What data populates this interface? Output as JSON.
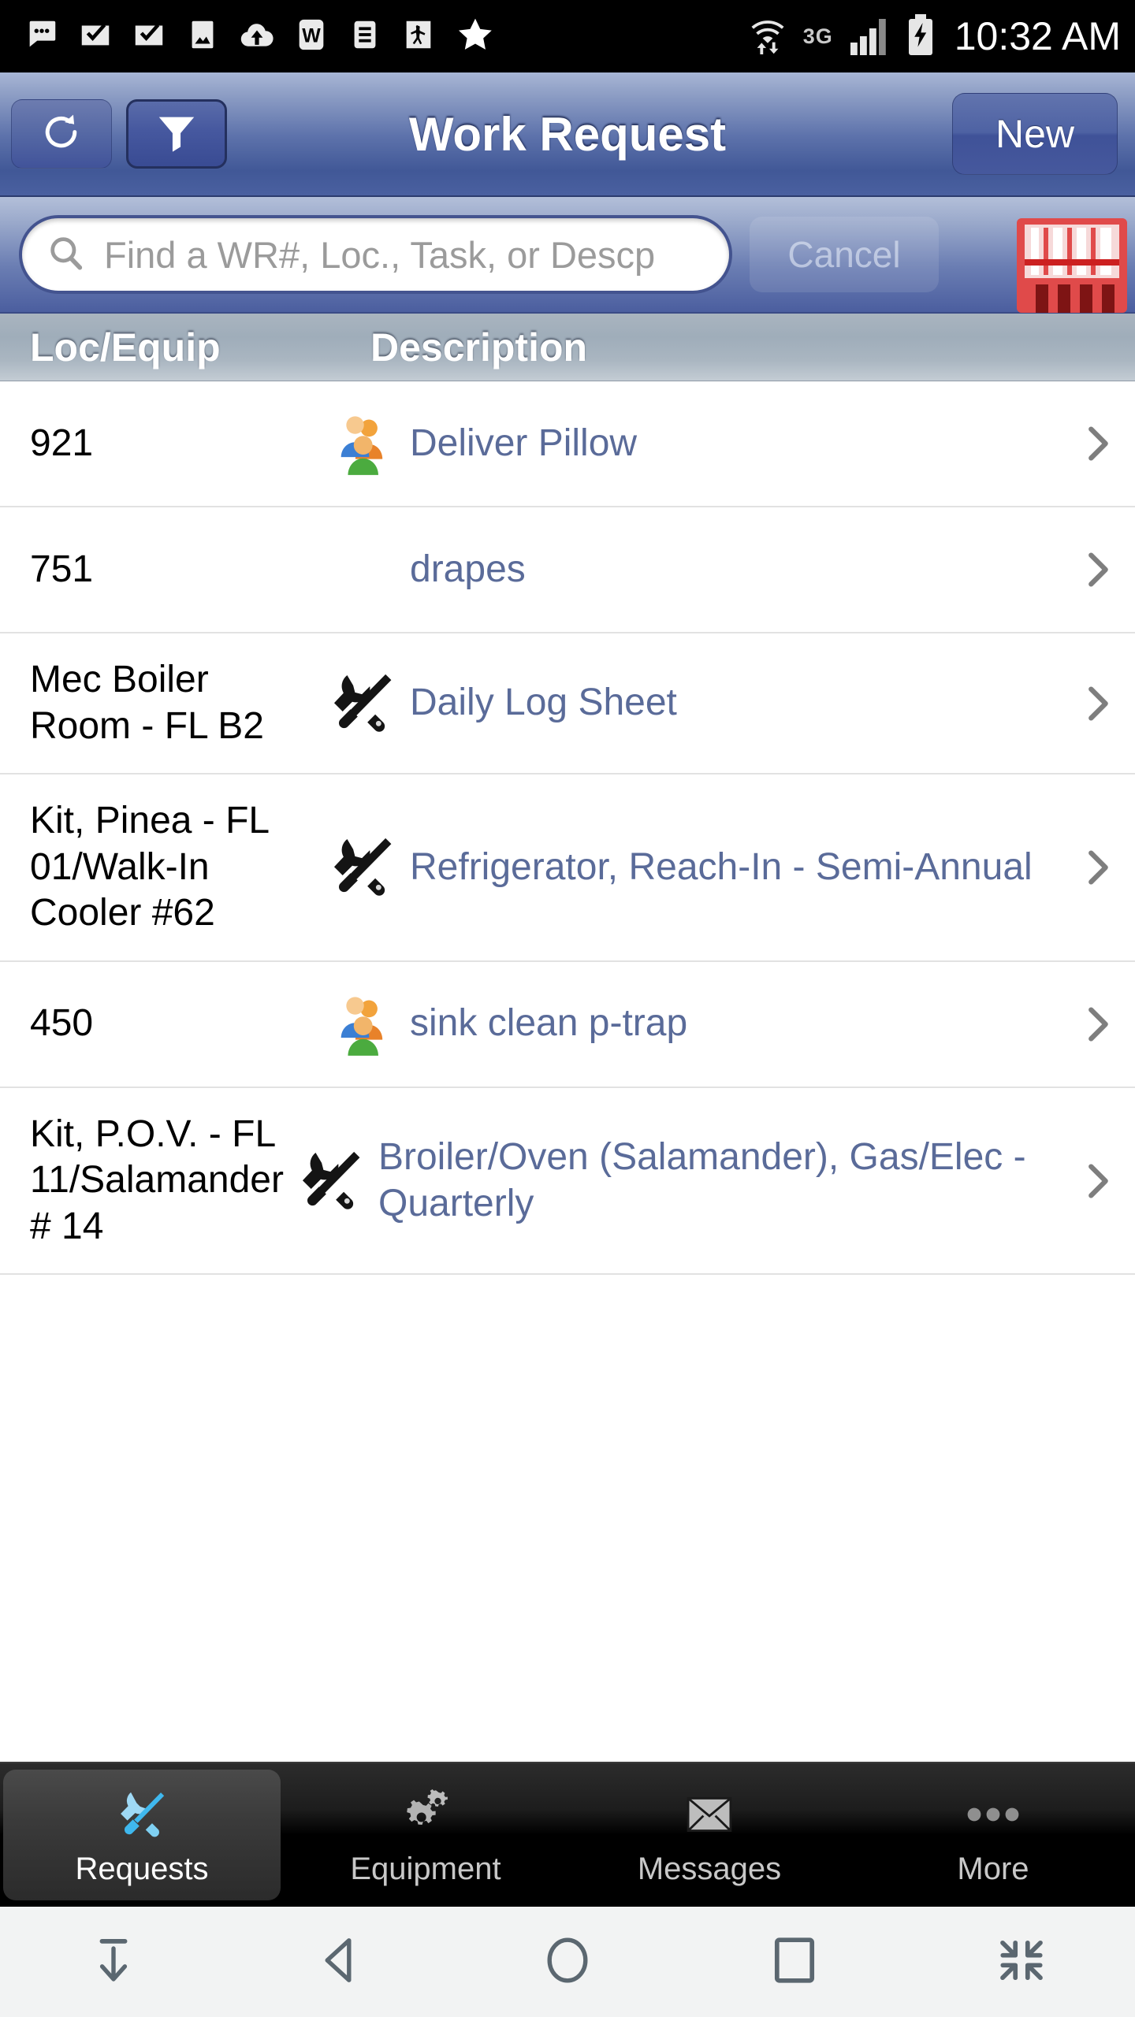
{
  "status_bar": {
    "time": "10:32 AM",
    "network_badge": "3G",
    "left_icons": [
      "messaging-dots-icon",
      "email-check-icon",
      "email-check-icon",
      "gallery-image-icon",
      "cloud-upload-icon",
      "word-document-icon",
      "text-document-icon",
      "adobe-reader-icon",
      "star-icon"
    ],
    "right_icons": [
      "wifi-icon",
      "signal-bars-icon",
      "battery-charging-icon"
    ]
  },
  "nav_bar": {
    "title": "Work Request",
    "refresh_icon": "refresh-icon",
    "filter_icon": "funnel-filter-icon",
    "new_label": "New"
  },
  "search": {
    "placeholder": "Find a WR#, Loc., Task, or Descp",
    "value": "",
    "search_icon": "search-icon",
    "cancel_label": "Cancel",
    "barcode_icon": "barcode-scan-icon"
  },
  "columns": {
    "loc_equip": "Loc/Equip",
    "description": "Description"
  },
  "rows": [
    {
      "loc": "921",
      "icon": "people-group-icon",
      "description": "Deliver Pillow",
      "chevron": "chevron-right-icon"
    },
    {
      "loc": "751",
      "icon": "none",
      "description": "drapes",
      "chevron": "chevron-right-icon"
    },
    {
      "loc": "Mec Boiler Room - FL B2",
      "icon": "tools-icon",
      "description": "Daily Log Sheet",
      "chevron": "chevron-right-icon"
    },
    {
      "loc": "Kit, Pinea - FL 01/Walk-In Cooler #62",
      "icon": "tools-icon",
      "description": "Refrigerator, Reach-In - Semi-Annual",
      "chevron": "chevron-right-icon"
    },
    {
      "loc": "450",
      "icon": "people-group-icon",
      "description": "sink clean p-trap",
      "chevron": "chevron-right-icon"
    },
    {
      "loc": "Kit, P.O.V. - FL 11/Salamander # 14",
      "icon": "tools-icon",
      "description": "Broiler/Oven (Salamander), Gas/Elec - Quarterly",
      "chevron": "chevron-right-icon"
    }
  ],
  "tab_bar": {
    "active": "Requests",
    "tabs": [
      {
        "label": "Requests",
        "icon": "tools-icon",
        "active": true
      },
      {
        "label": "Equipment",
        "icon": "gears-icon",
        "active": false
      },
      {
        "label": "Messages",
        "icon": "envelope-icon",
        "active": false
      },
      {
        "label": "More",
        "icon": "ellipsis-icon",
        "active": false
      }
    ]
  },
  "system_nav": {
    "buttons": [
      {
        "name": "hide-keyboard-icon"
      },
      {
        "name": "back-icon"
      },
      {
        "name": "home-icon"
      },
      {
        "name": "recents-icon"
      },
      {
        "name": "shrink-screen-icon"
      }
    ]
  },
  "colors": {
    "navbar_blue": "#4b5e9f",
    "link_text": "#5a6b99",
    "accent_red": "#d33030",
    "tab_active_icon": "#5ec8f2"
  }
}
